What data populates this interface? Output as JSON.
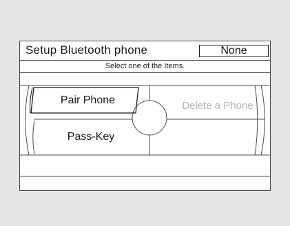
{
  "header": {
    "title": "Setup Bluetooth phone",
    "status_value": "None"
  },
  "instruction": "Select one of the Items.",
  "menu": {
    "items": [
      {
        "label": "Pair Phone",
        "state": "selected"
      },
      {
        "label": "Pass-Key",
        "state": "enabled"
      },
      {
        "label": "Delete a Phone",
        "state": "disabled"
      }
    ]
  },
  "colors": {
    "background": "#e6e6e6",
    "screen": "#ffffff",
    "line": "#4a4a4a",
    "disabled_text": "#b4b4b4"
  }
}
